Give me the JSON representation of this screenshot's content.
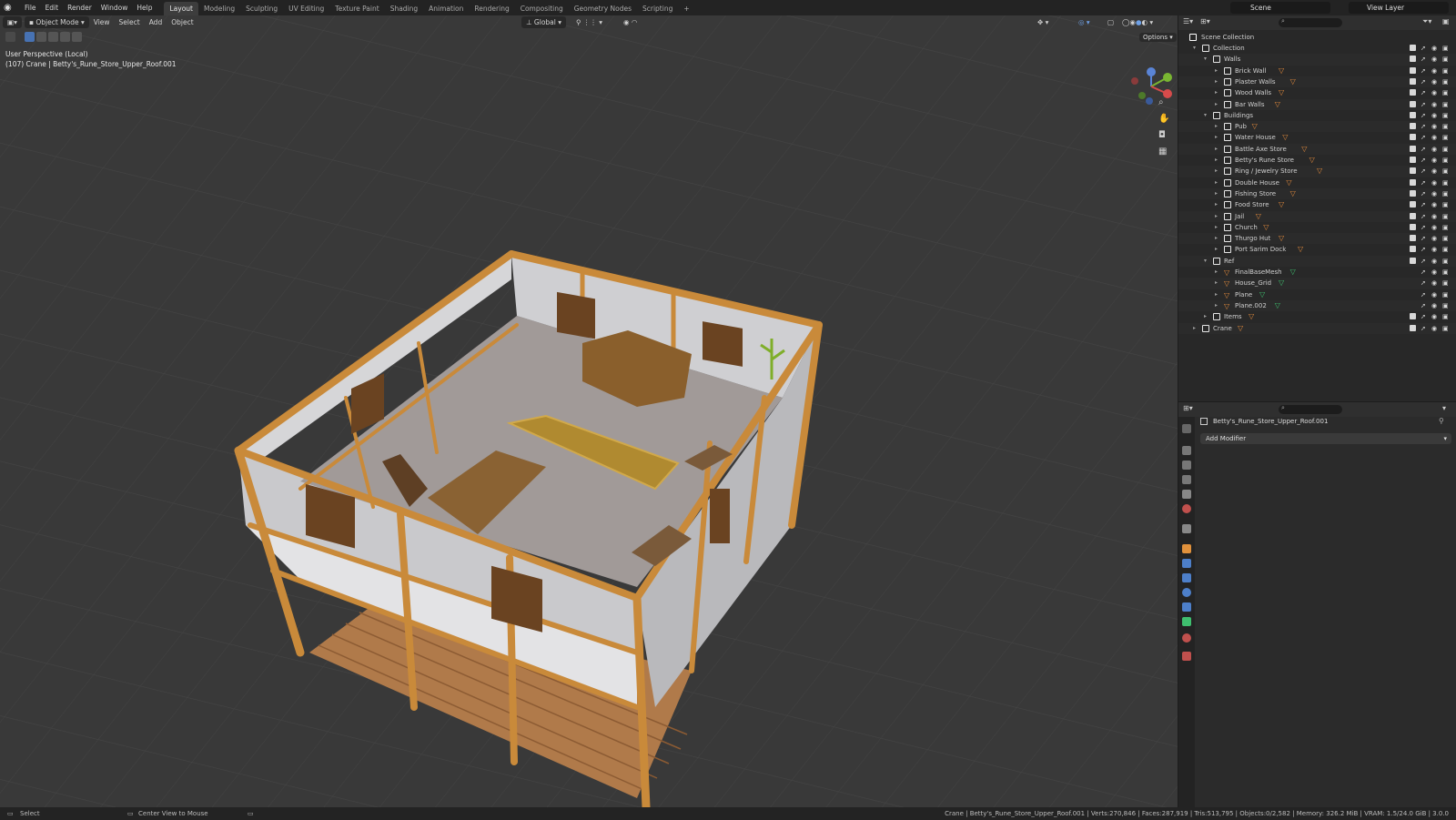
{
  "topbar": {
    "menus": [
      "File",
      "Edit",
      "Render",
      "Window",
      "Help"
    ],
    "workspaces": [
      "Layout",
      "Modeling",
      "Sculpting",
      "UV Editing",
      "Texture Paint",
      "Shading",
      "Animation",
      "Rendering",
      "Compositing",
      "Geometry Nodes",
      "Scripting"
    ],
    "active_workspace": "Layout",
    "add_tab": "+",
    "scene_label": "Scene",
    "view_layer_label": "View Layer"
  },
  "viewport_header": {
    "mode": "Object Mode",
    "menus": [
      "View",
      "Select",
      "Add",
      "Object"
    ],
    "orientation": "Global",
    "options": "Options"
  },
  "viewport_overlay": {
    "line1": "User Perspective (Local)",
    "line2": "(107) Crane | Betty's_Rune_Store_Upper_Roof.001"
  },
  "gizmo": {
    "x": "X",
    "y": "Y",
    "z": "Z"
  },
  "outliner": {
    "search_placeholder": "",
    "scene_collection": "Scene Collection",
    "rows": [
      {
        "label": "Collection",
        "indent": 1,
        "kind": "collection",
        "caret": "open"
      },
      {
        "label": "Walls",
        "indent": 2,
        "kind": "collection",
        "caret": "open"
      },
      {
        "label": "Brick Wall",
        "indent": 3,
        "kind": "collection",
        "caret": "closed"
      },
      {
        "label": "Plaster Walls",
        "indent": 3,
        "kind": "collection",
        "caret": "closed"
      },
      {
        "label": "Wood Walls",
        "indent": 3,
        "kind": "collection",
        "caret": "closed"
      },
      {
        "label": "Bar Walls",
        "indent": 3,
        "kind": "collection",
        "caret": "closed"
      },
      {
        "label": "Buildings",
        "indent": 2,
        "kind": "collection",
        "caret": "open"
      },
      {
        "label": "Pub",
        "indent": 3,
        "kind": "collection",
        "caret": "closed"
      },
      {
        "label": "Water House",
        "indent": 3,
        "kind": "collection",
        "caret": "closed"
      },
      {
        "label": "Battle Axe Store",
        "indent": 3,
        "kind": "collection",
        "caret": "closed"
      },
      {
        "label": "Betty's Rune Store",
        "indent": 3,
        "kind": "collection",
        "caret": "closed"
      },
      {
        "label": "Ring / Jewelry Store",
        "indent": 3,
        "kind": "collection",
        "caret": "closed"
      },
      {
        "label": "Double House",
        "indent": 3,
        "kind": "collection",
        "caret": "closed"
      },
      {
        "label": "Fishing Store",
        "indent": 3,
        "kind": "collection",
        "caret": "closed"
      },
      {
        "label": "Food Store",
        "indent": 3,
        "kind": "collection",
        "caret": "closed"
      },
      {
        "label": "Jail",
        "indent": 3,
        "kind": "collection",
        "caret": "closed"
      },
      {
        "label": "Church",
        "indent": 3,
        "kind": "collection",
        "caret": "closed"
      },
      {
        "label": "Thurgo Hut",
        "indent": 3,
        "kind": "collection",
        "caret": "closed"
      },
      {
        "label": "Port Sarim Dock",
        "indent": 3,
        "kind": "collection",
        "caret": "closed"
      },
      {
        "label": "Ref",
        "indent": 2,
        "kind": "collection",
        "caret": "open"
      },
      {
        "label": "FinalBaseMesh",
        "indent": 3,
        "kind": "mesh",
        "caret": "closed"
      },
      {
        "label": "House_Grid",
        "indent": 3,
        "kind": "mesh",
        "caret": "closed"
      },
      {
        "label": "Plane",
        "indent": 3,
        "kind": "mesh",
        "caret": "closed"
      },
      {
        "label": "Plane.002",
        "indent": 3,
        "kind": "mesh",
        "caret": "closed"
      },
      {
        "label": "Items",
        "indent": 2,
        "kind": "collection",
        "caret": "closed"
      },
      {
        "label": "Crane",
        "indent": 1,
        "kind": "collection",
        "caret": "closed"
      }
    ]
  },
  "properties": {
    "object_name": "Betty's_Rune_Store_Upper_Roof.001",
    "add_modifier": "Add Modifier"
  },
  "statusbar": {
    "left": "Select",
    "middle": "Center View to Mouse",
    "right": "Crane | Betty's_Rune_Store_Upper_Roof.001 | Verts:270,846 | Faces:287,919 | Tris:513,795 | Objects:0/2,582 | Memory: 326.2 MiB | VRAM: 1.5/24.0 GiB | 3.0.0"
  },
  "colors": {
    "accent": "#4772b3",
    "wood": "#c98a3a",
    "plaster": "#c9c9cc",
    "floor": "#a39c9a",
    "grid_bg": "#3a3a3a",
    "mesh_icon": "#e28a3c",
    "mesh_green": "#3fbf6f"
  }
}
